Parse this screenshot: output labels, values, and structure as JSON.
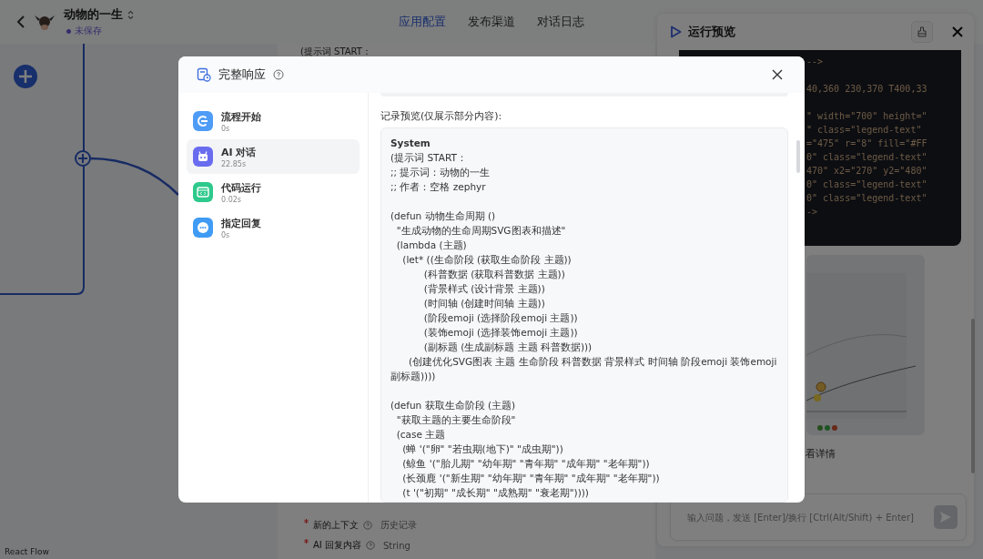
{
  "app": {
    "name": "动物的一生",
    "status": "未保存"
  },
  "nav_tabs": [
    {
      "label": "应用配置",
      "selected": true
    },
    {
      "label": "发布渠道",
      "selected": false
    },
    {
      "label": "对话日志",
      "selected": false
    }
  ],
  "canvas": {
    "footer": "React Flow"
  },
  "editor": {
    "top_text": "(提示词 START：",
    "fields": [
      {
        "label": "新的上下文",
        "required": true,
        "type": "历史记录"
      },
      {
        "label": "AI 回复内容",
        "required": true,
        "type": "String"
      }
    ]
  },
  "preview": {
    "title": "运行预览",
    "code_groups": [
      [
        "-->"
      ],
      [
        "40,360 230,370 T400,33"
      ],
      [
        "\" width=\"700\" height=\"",
        "\" class=\"legend-text\"",
        "=\"475\" r=\"8\" fill=\"#FF",
        "0\" class=\"legend-text\"",
        "470\" x2=\"270\" y2=\"480\"",
        "0\" class=\"legend-text\"",
        "0\" class=\"legend-text\"",
        "->"
      ]
    ],
    "link": "看详情",
    "input": {
      "placeholder": "输入问题，发送 [Enter]/换行 [Ctrl(Alt/Shift) + Enter]"
    }
  },
  "modal": {
    "title": "完整响应",
    "nodes": [
      {
        "kind": "start",
        "name": "流程开始",
        "time": "0s",
        "color": "#4e9cf6",
        "selected": false
      },
      {
        "kind": "ai",
        "name": "AI 对话",
        "time": "22.85s",
        "color": "#6a6cf0",
        "selected": true
      },
      {
        "kind": "code",
        "name": "代码运行",
        "time": "0.02s",
        "color": "#2ec98c",
        "selected": false
      },
      {
        "kind": "reply",
        "name": "指定回复",
        "time": "0s",
        "color": "#3f9bf3",
        "selected": false
      }
    ],
    "record_label": "记录预览(仅展示部分内容):",
    "record": {
      "role": "System",
      "blocks": [
        [
          "(提示词 START：",
          ";; 提示词：动物的一生",
          ";; 作者：空格 zephyr"
        ],
        [
          "(defun 动物生命周期 ()",
          "  \"生成动物的生命周期SVG图表和描述\"",
          "  (lambda (主题)",
          "    (let* ((生命阶段 (获取生命阶段 主题))",
          "           (科普数据 (获取科普数据 主题))",
          "           (背景样式 (设计背景 主题))",
          "           (时间轴 (创建时间轴 主题))",
          "           (阶段emoji (选择阶段emoji 主题))",
          "           (装饰emoji (选择装饰emoji 主题))",
          "           (副标题 (生成副标题 主题 科普数据)))",
          "      (创建优化SVG图表 主题 生命阶段 科普数据 背景样式 时间轴 阶段emoji 装饰emoji 副标题))))"
        ],
        [
          "(defun 获取生命阶段 (主题)",
          "  \"获取主题的主要生命阶段\"",
          "  (case 主题",
          "    (蝉 '(\"卵\" \"若虫期(地下)\" \"成虫期\"))",
          "    (鲸鱼 '(\"胎儿期\" \"幼年期\" \"青年期\" \"成年期\" \"老年期\"))",
          "    (长颈鹿 '(\"新生期\" \"幼年期\" \"青年期\" \"成年期\" \"老年期\"))",
          "    (t '(\"初期\" \"成长期\" \"成熟期\" \"衰老期\"))))"
        ]
      ]
    }
  }
}
